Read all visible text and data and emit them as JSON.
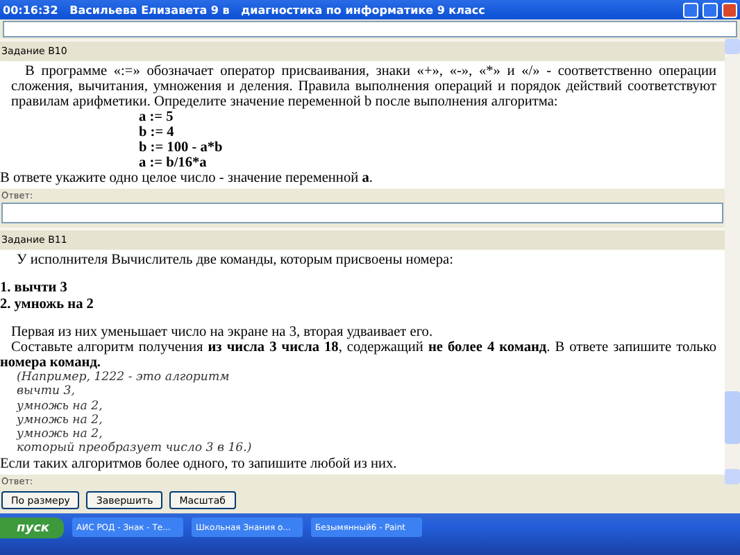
{
  "window": {
    "title": "00:16:32   Васильева Елизавета 9 в   диагностика по информатике 9 класс"
  },
  "tasks": [
    {
      "header": "Задание B10",
      "blocks": [
        {
          "kind": "paragraph",
          "text": "В программе «:=» обозначает оператор присваивания, знаки «+», «-», «*» и «/» - соответственно операции сложения, вычитания, умножения и деления. Правила выполнения операций и порядок действий соответствуют правилам арифметики. Определите значение переменной b после выполнения алгоритма:"
        },
        {
          "kind": "code",
          "text": "a := 5"
        },
        {
          "kind": "code",
          "text": "b := 4"
        },
        {
          "kind": "code",
          "text": "b := 100 - a*b"
        },
        {
          "kind": "code",
          "text": "a := b/16*a"
        },
        {
          "kind": "note",
          "text": "В ответе укажите одно целое число - значение переменной **a**."
        }
      ],
      "answer": {
        "label": "Ответ:"
      }
    },
    {
      "header": "Задание B11",
      "blocks": [
        {
          "kind": "lead",
          "text": "У исполнителя Вычислитель две команды, которым присвоены номера:"
        },
        {
          "kind": "command",
          "text": "1. вычти 3"
        },
        {
          "kind": "command",
          "text": "2. умножь на 2"
        },
        {
          "kind": "paragraph",
          "text": "Первая из них уменьшает число на экране на 3, вторая удваивает его."
        },
        {
          "kind": "paragraph",
          "text": "Составьте алгоритм получения **из числа 3 числа 18**, содержащий **не более 4 команд**. В ответе запишите только **номера команд.**"
        },
        {
          "kind": "example",
          "text": "(Например, 1222 - это алгоритм"
        },
        {
          "kind": "example",
          "text": "вычти 3,"
        },
        {
          "kind": "example",
          "text": "умножь на 2,"
        },
        {
          "kind": "example",
          "text": "умножь на 2,"
        },
        {
          "kind": "example",
          "text": "умножь на 2,"
        },
        {
          "kind": "example",
          "text": "который преобразует число 3 в 16.)"
        },
        {
          "kind": "note",
          "text": "Если таких алгоритмов более одного, то запишите любой из них."
        }
      ],
      "answer": {
        "label": "Ответ:"
      }
    }
  ],
  "buttons": [
    "По размеру",
    "Завершить",
    "Масштаб"
  ],
  "taskbar": {
    "start": "пуск",
    "items": [
      {
        "label": "АИС РОД - Знак - Те...",
        "selected": false
      },
      {
        "label": "Школьная Знания о...",
        "selected": false
      },
      {
        "label": "Безымянный6 - Paint",
        "selected": false
      }
    ]
  }
}
